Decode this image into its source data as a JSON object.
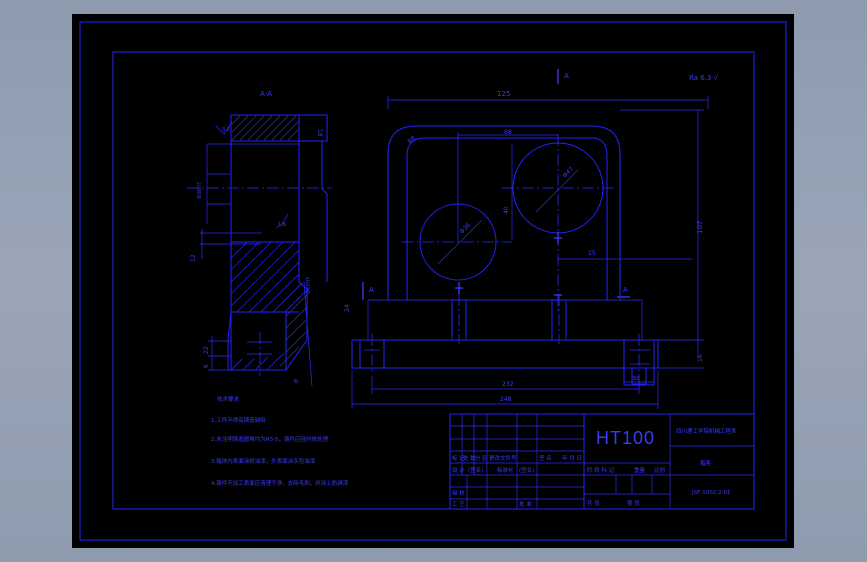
{
  "title_block": {
    "material": "HT100",
    "school": "四川理工学院机械工程系",
    "part_name": "箱座",
    "drawing_no": "JSF-1002.2-01",
    "scale_label": "比例",
    "weight_label": "重量",
    "stage_marks_label": "阶 段 标 记",
    "quantity_label": "共  张",
    "sheet_label": "第  张",
    "revision_header": [
      "标 记",
      "处 数",
      "分 区",
      "更改文件号",
      "签 名",
      "年 月 日"
    ],
    "designer_row": [
      "设 计",
      "(签名)",
      "标准化",
      "(签名)"
    ],
    "review_label": "审 核",
    "process_label": "工 艺",
    "approve_label": "批 准"
  },
  "tech_requirements": {
    "heading": "技术要求",
    "items": [
      "1.工件不得有铸造缺陷",
      "2.未注明铸造圆角均为R3-5，铸件应经时效处理",
      "3.箱体内表面涂耐油漆，外表面涂灰色油漆",
      "4.铸件不加工表面应清理干净，去除毛刺，并涂上防锈漆"
    ]
  },
  "labels": {
    "section_view": "A-A",
    "section_A_top": "A",
    "section_A_left": "A",
    "section_A_right": "A",
    "roughness_top_right": "Ra 6.3 √",
    "dim_125": "125",
    "dim_68": "68",
    "dim_40": "40",
    "dim_107": "107",
    "dim_15": "15",
    "dim_18": "18",
    "dim_R8": "R8",
    "dim_D47": "Φ47",
    "dim_D36": "Φ36",
    "dim_232": "232",
    "dim_248": "248",
    "dim_16": "16",
    "dim_30": "30",
    "dim_24": "24",
    "dim_12": "12",
    "dim_22": "22",
    "dim_8": "8",
    "dim_6": "6",
    "dim_A_left_a": "Φ36H7",
    "dim_A_left_b": "Φ47H7",
    "roughness_a": "3.2",
    "roughness_b": "1.6"
  }
}
